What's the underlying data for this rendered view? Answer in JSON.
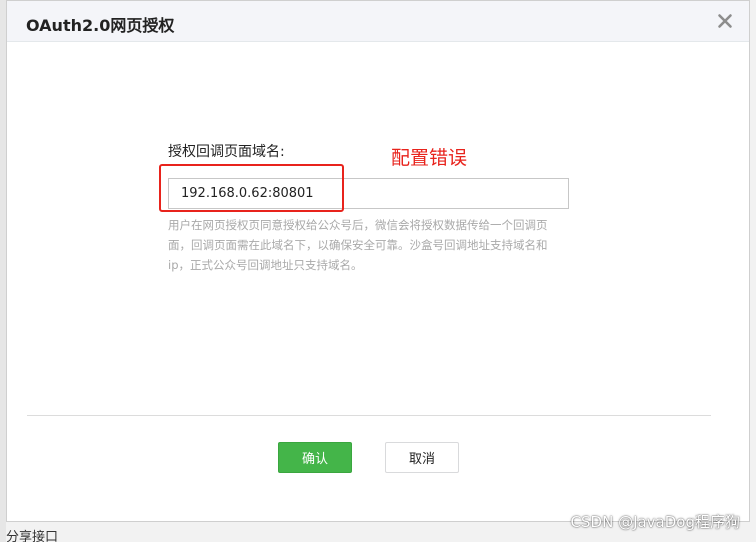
{
  "dialog": {
    "title": "OAuth2.0网页授权",
    "close_icon": "close-icon"
  },
  "form": {
    "label": "授权回调页面域名:",
    "input_value": "192.168.0.62:80801",
    "help_text": "用户在网页授权页同意授权给公众号后，微信会将授权数据传给一个回调页面，回调页面需在此域名下，以确保安全可靠。沙盒号回调地址支持域名和ip，正式公众号回调地址只支持域名。"
  },
  "annotation": {
    "text": "配置错误",
    "color": "#e8231c"
  },
  "buttons": {
    "confirm_label": "确认",
    "cancel_label": "取消",
    "confirm_color": "#44b549"
  },
  "background": {
    "bottom_label": "分享接口"
  },
  "watermark": "CSDN @JavaDog程序狗"
}
